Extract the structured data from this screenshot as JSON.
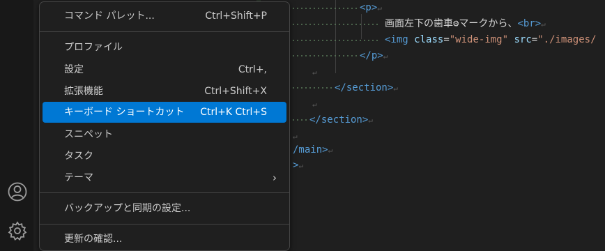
{
  "activity_bar": {
    "icons": [
      "account-icon",
      "manage-gear-icon"
    ]
  },
  "code": {
    "lines": [
      {
        "tokens": [
          [
            "tag",
            "<p>"
          ],
          [
            "nl",
            "↵"
          ]
        ]
      },
      {
        "tokens": [
          [
            "text",
            "画面左下の歯車⚙マークから、"
          ],
          [
            "tag",
            "<br>"
          ],
          [
            "nl",
            "↵"
          ]
        ]
      },
      {
        "tokens": [
          [
            "tag",
            "<img "
          ],
          [
            "attr",
            "class"
          ],
          [
            "text",
            "="
          ],
          [
            "str",
            "\"wide-img\""
          ],
          [
            "text",
            " "
          ],
          [
            "attr",
            "src"
          ],
          [
            "text",
            "="
          ],
          [
            "str",
            "\"./images/"
          ]
        ]
      },
      {
        "tokens": [
          [
            "tag",
            "</p>"
          ],
          [
            "nl",
            "↵"
          ]
        ]
      },
      {
        "tokens": [
          [
            "nl",
            "↵"
          ]
        ]
      },
      {
        "tokens": [
          [
            "tag",
            "</section>"
          ],
          [
            "nl",
            "↵"
          ]
        ]
      },
      {
        "tokens": [
          [
            "nl",
            "↵"
          ]
        ]
      },
      {
        "tokens": [
          [
            "tag",
            "</section>"
          ],
          [
            "nl",
            "↵"
          ]
        ]
      },
      {
        "tokens": [
          [
            "nl",
            "↵"
          ]
        ]
      },
      {
        "tokens": [
          [
            "tag",
            "/main>"
          ],
          [
            "nl",
            "↵"
          ]
        ]
      },
      {
        "tokens": [
          [
            "tag",
            ">"
          ],
          [
            "nl",
            "↵"
          ]
        ]
      }
    ]
  },
  "menu": {
    "items": [
      {
        "label": "コマンド パレット...",
        "shortcut": "Ctrl+Shift+P"
      },
      {
        "label": "プロファイル",
        "shortcut": ""
      },
      {
        "label": "設定",
        "shortcut": "Ctrl+,"
      },
      {
        "label": "拡張機能",
        "shortcut": "Ctrl+Shift+X"
      },
      {
        "label": "キーボード ショートカット",
        "shortcut": "Ctrl+K Ctrl+S",
        "active": true
      },
      {
        "label": "スニペット",
        "shortcut": ""
      },
      {
        "label": "タスク",
        "shortcut": ""
      },
      {
        "label": "テーマ",
        "shortcut": "",
        "submenu": "›"
      },
      {
        "label": "バックアップと同期の設定...",
        "shortcut": ""
      },
      {
        "label": "更新の確認...",
        "shortcut": ""
      }
    ]
  },
  "colors": {
    "accent": "#0078d4",
    "menu_bg": "#1f1f1f",
    "editor_bg": "#1f1f1f"
  }
}
